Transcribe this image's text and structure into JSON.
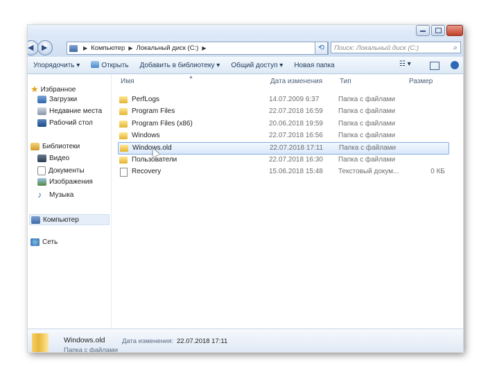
{
  "address": {
    "segments": [
      "Компьютер",
      "Локальный диск (C:)"
    ],
    "search_placeholder": "Поиск: Локальный диск (C:)"
  },
  "toolbar": {
    "organize": "Упорядочить ▾",
    "open": "Открыть",
    "add_to_library": "Добавить в библиотеку ▾",
    "share": "Общий доступ ▾",
    "new_folder": "Новая папка"
  },
  "nav": {
    "favorites": "Избранное",
    "downloads": "Загрузки",
    "recent": "Недавние места",
    "desktop": "Рабочий стол",
    "libraries": "Библиотеки",
    "video": "Видео",
    "documents": "Документы",
    "images": "Изображения",
    "music": "Музыка",
    "computer": "Компьютер",
    "network": "Сеть"
  },
  "columns": {
    "name": "Имя",
    "date": "Дата изменения",
    "type": "Тип",
    "size": "Размер"
  },
  "files": [
    {
      "name": "PerfLogs",
      "date": "14.07.2009 6:37",
      "type": "Папка с файлами",
      "size": ""
    },
    {
      "name": "Program Files",
      "date": "22.07.2018 16:59",
      "type": "Папка с файлами",
      "size": ""
    },
    {
      "name": "Program Files (x86)",
      "date": "20.06.2018 19:59",
      "type": "Папка с файлами",
      "size": ""
    },
    {
      "name": "Windows",
      "date": "22.07.2018 16:56",
      "type": "Папка с файлами",
      "size": ""
    },
    {
      "name": "Windows.old",
      "date": "22.07.2018 17:11",
      "type": "Папка с файлами",
      "size": ""
    },
    {
      "name": "Пользователи",
      "date": "22.07.2018 16:30",
      "type": "Папка с файлами",
      "size": ""
    },
    {
      "name": "Recovery",
      "date": "15.06.2018 15:48",
      "type": "Текстовый докум...",
      "size": "0 КБ"
    }
  ],
  "details": {
    "name": "Windows.old",
    "date_label": "Дата изменения:",
    "date_value": "22.07.2018 17:11",
    "type": "Папка с файлами"
  },
  "colors": {
    "selection_border": "#84acdd",
    "folder_yellow": "#e2b431",
    "toolbar_bg": "#dde9f6"
  }
}
